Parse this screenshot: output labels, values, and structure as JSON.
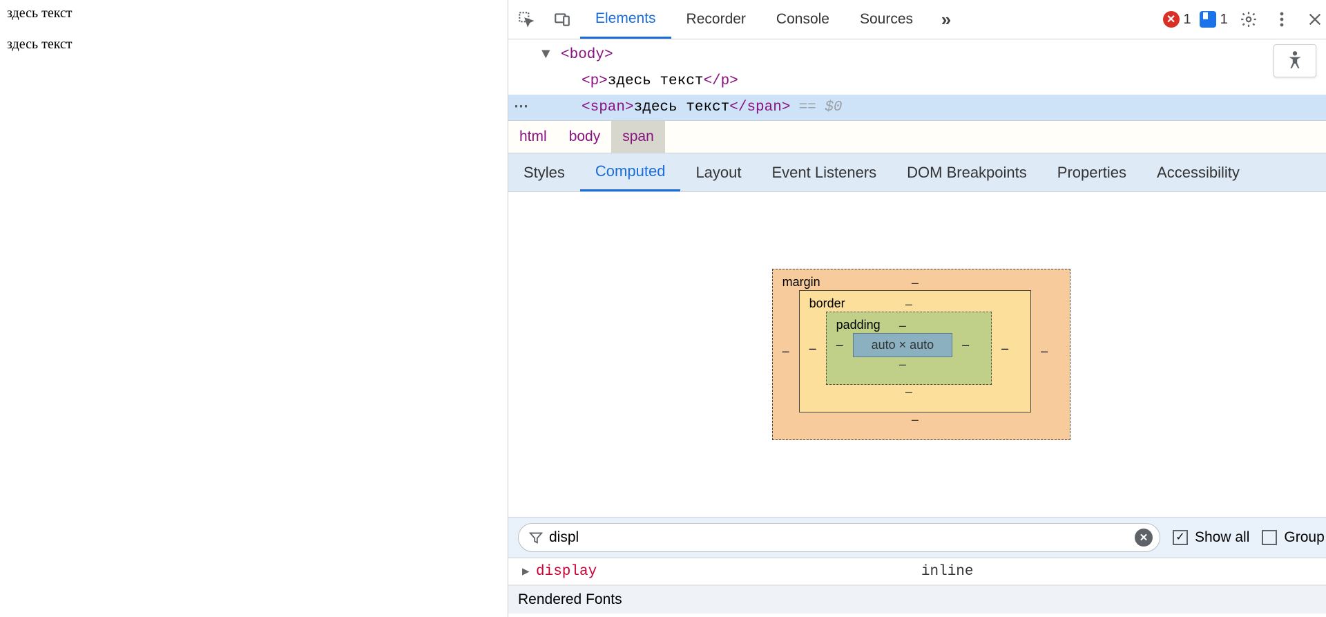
{
  "page": {
    "paragraph": "здесь текст",
    "span_text": "здесь текст"
  },
  "toolbar": {
    "tabs": [
      "Elements",
      "Recorder",
      "Console",
      "Sources"
    ],
    "active_tab_index": 0,
    "errors_count": "1",
    "issues_count": "1"
  },
  "dom": {
    "body_open": "<body>",
    "p_open": "<p>",
    "p_text": "здесь текст",
    "p_close": "</p>",
    "span_open": "<span>",
    "span_text": "здесь текст",
    "span_close": "</span>",
    "eq0": "== $0"
  },
  "crumbs": [
    "html",
    "body",
    "span"
  ],
  "crumbs_active_index": 2,
  "subtabs": [
    "Styles",
    "Computed",
    "Layout",
    "Event Listeners",
    "DOM Breakpoints",
    "Properties",
    "Accessibility"
  ],
  "subtabs_active_index": 1,
  "boxmodel": {
    "margin_label": "margin",
    "border_label": "border",
    "padding_label": "padding",
    "content": "auto × auto",
    "dash": "–"
  },
  "filter": {
    "value": "displ",
    "show_all_label": "Show all",
    "group_label": "Group",
    "show_all_checked": true,
    "group_checked": false
  },
  "computed_row": {
    "name": "display",
    "value": "inline"
  },
  "rendered_fonts_label": "Rendered Fonts"
}
